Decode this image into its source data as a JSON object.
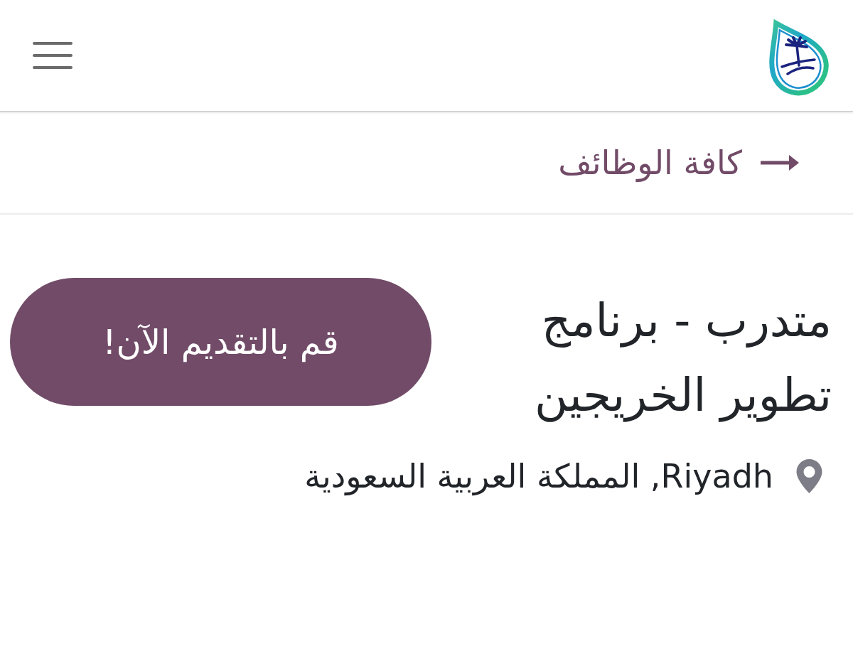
{
  "back_link": {
    "label": "كافة الوظائف"
  },
  "job": {
    "title": "متدرب - برنامج تطوير الخريجين",
    "apply_button": "قم بالتقديم الآن!",
    "location": "Riyadh, المملكة العربية السعودية"
  }
}
